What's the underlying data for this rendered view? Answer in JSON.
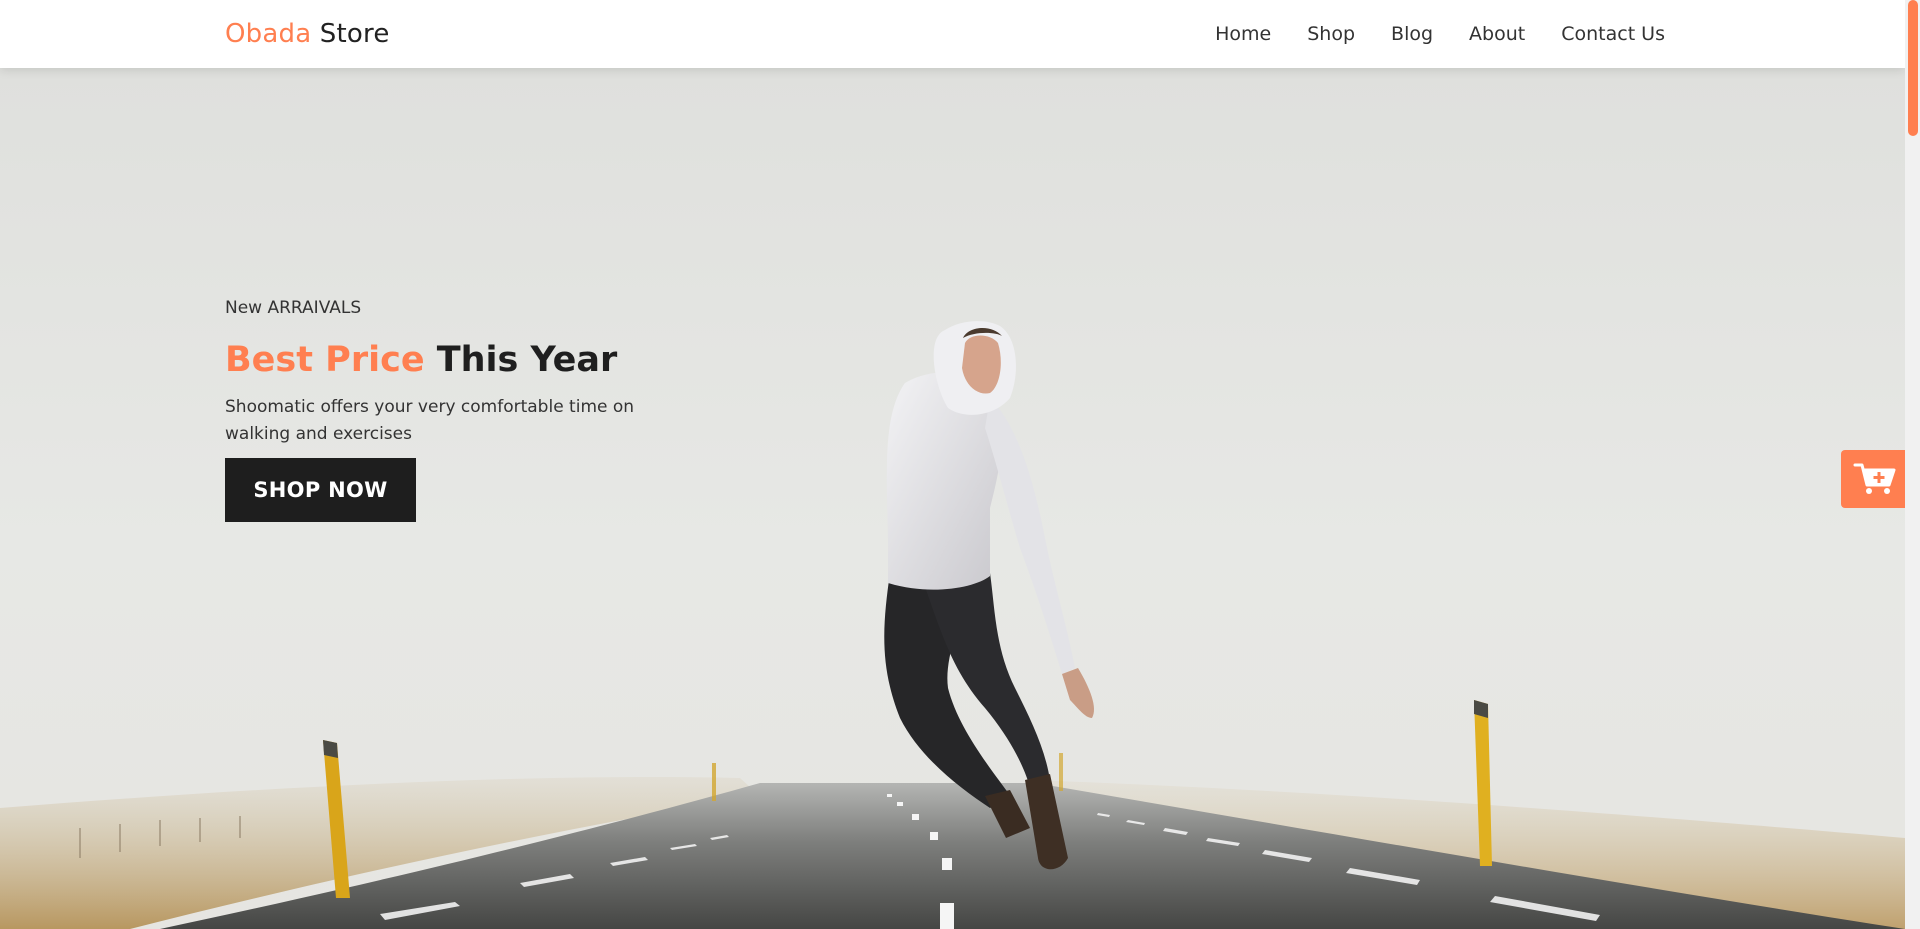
{
  "header": {
    "logo_accent": "Obada",
    "logo_rest": " Store",
    "nav": [
      {
        "label": "Home"
      },
      {
        "label": "Shop"
      },
      {
        "label": "Blog"
      },
      {
        "label": "About"
      },
      {
        "label": "Contact Us"
      }
    ]
  },
  "hero": {
    "eyebrow": "New ARRAIVALS",
    "title_accent": "Best Price",
    "title_rest": " This Year",
    "description": "Shoomatic offers your very comfortable time on walking and exercises",
    "cta_label": "SHOP NOW"
  },
  "floating_cart": {
    "icon": "cart-plus-icon"
  },
  "colors": {
    "accent": "#ff7f50",
    "dark": "#1e1e1e",
    "text": "#333333"
  }
}
